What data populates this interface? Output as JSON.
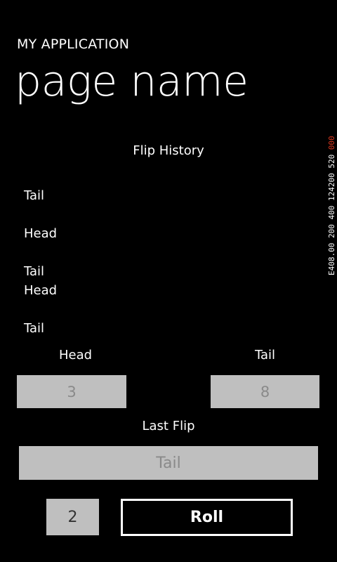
{
  "app": {
    "title": "MY APPLICATION",
    "page_name": "page name"
  },
  "frame_counter": {
    "prefix": "E408.00 200 400 124200 520 ",
    "accent": "000",
    "accent_color": "#e0391f"
  },
  "history": {
    "label": "Flip History",
    "items": [
      "Tail",
      "Head",
      "Tail",
      "Head",
      "Tail"
    ]
  },
  "totals": {
    "head_label": "Head",
    "tail_label": "Tail",
    "head_count": "3",
    "tail_count": "8"
  },
  "last_flip": {
    "label": "Last Flip",
    "value": "Tail"
  },
  "roll": {
    "count": "2",
    "button_label": "Roll"
  },
  "colors": {
    "background": "#000000",
    "foreground": "#ffffff",
    "box_fill": "#bfbfbf",
    "box_text": "#8a8a8a"
  }
}
